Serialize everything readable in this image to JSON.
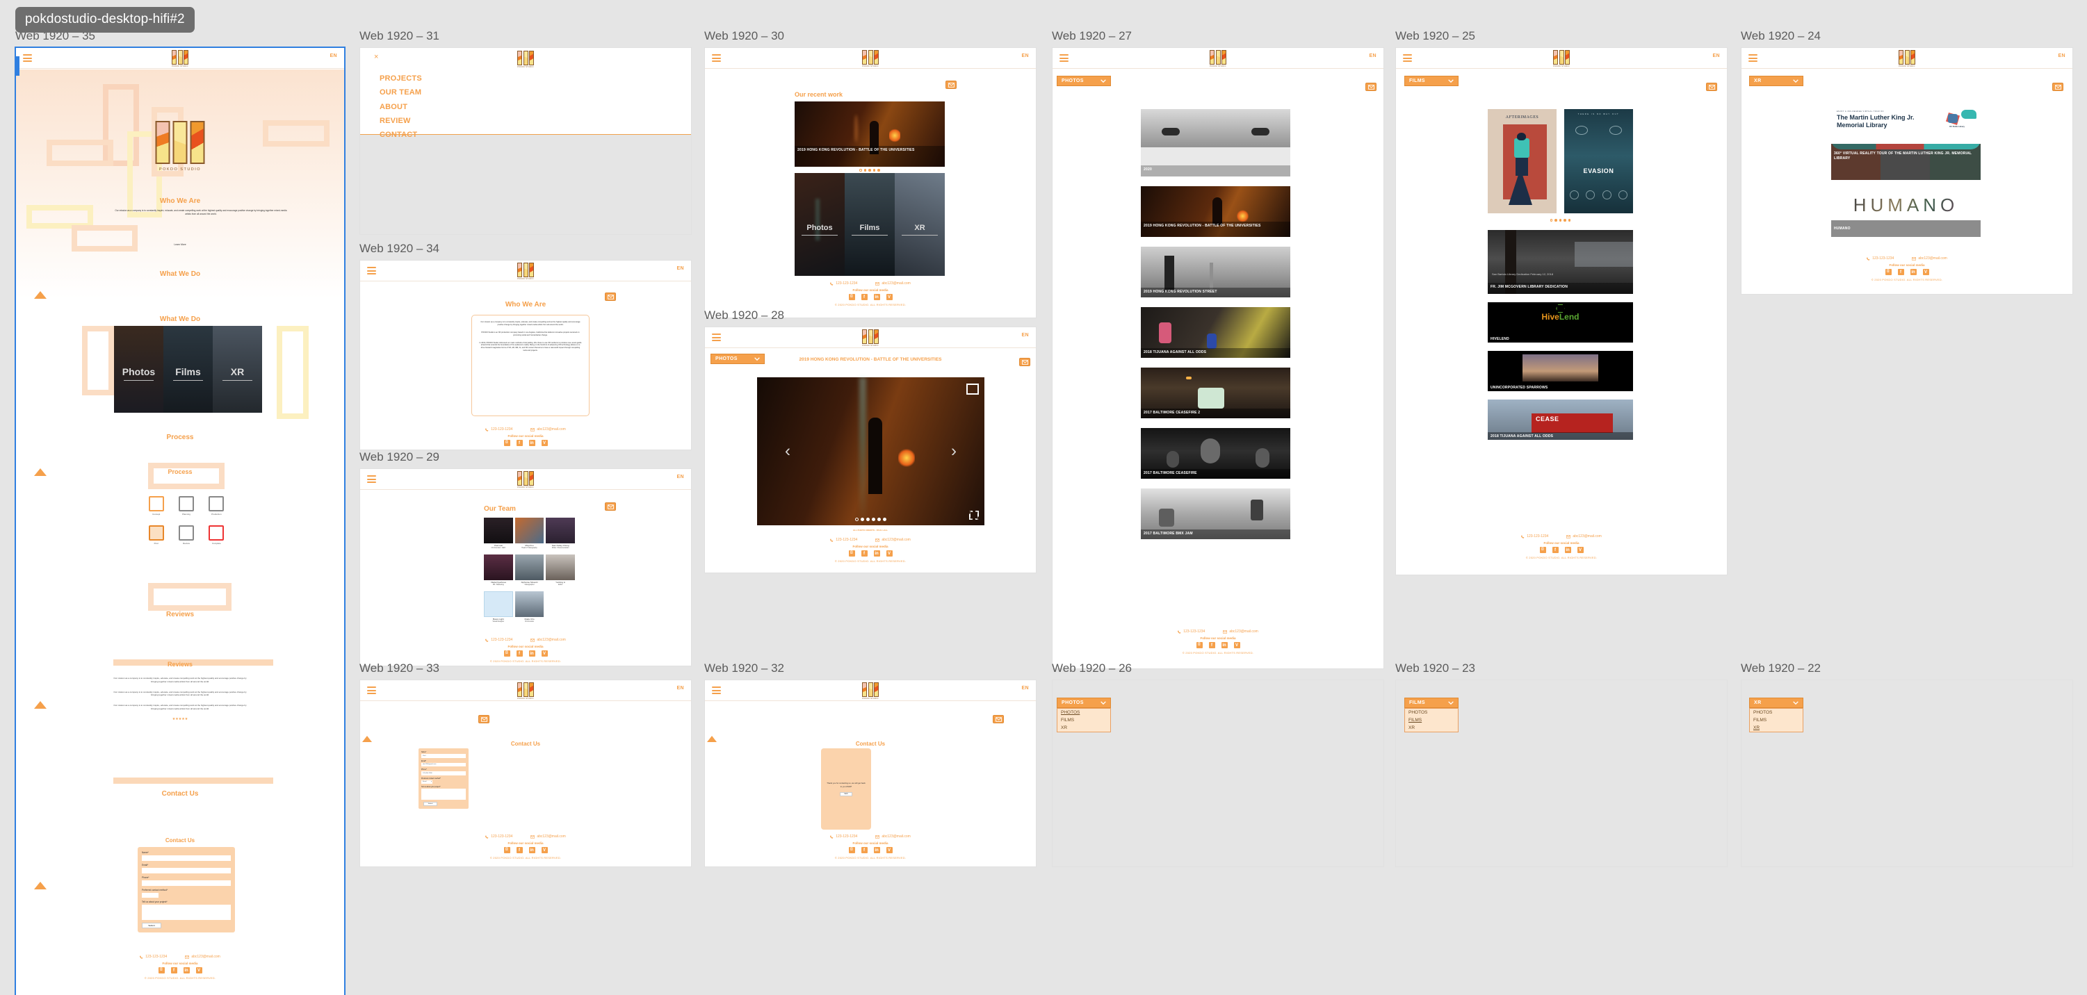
{
  "page": {
    "title": "pokdostudio-desktop-hifi#2"
  },
  "brand": {
    "accent": "#f5a04b",
    "accent_dark": "#e8872a",
    "logo_caption": "POKDO STUDIO",
    "lang": "EN"
  },
  "footer": {
    "phone": "123-123-1234",
    "email": "abc123@mail.com",
    "follow": "Follow our social media",
    "copyright": "© 2020 POKDO STUDIO. ALL RIGHTS RESERVED.",
    "socials": [
      "instagram",
      "facebook",
      "linkedin",
      "vimeo"
    ]
  },
  "frames": [
    {
      "label": "Web 1920 – 35",
      "sections": {
        "who_we_are": "Who We Are",
        "who_we_are_body": "Our mission as a company is to constantly inspire, educate, and create compelling work at the highest quality and encourage positive change by bringing together mixed-media artists from all around the world.",
        "learn_more": "Learn More",
        "what_we_do": "What We Do",
        "what_we_do_2": "What We Do",
        "process": "Process",
        "process_2": "Process",
        "reviews": "Reviews",
        "reviews_2": "Reviews",
        "contact_us": "Contact Us",
        "contact_us_2": "Contact Us"
      },
      "tiles": [
        "Photos",
        "Films",
        "XR"
      ],
      "process_steps": [
        "Concept",
        "Planning",
        "Production",
        "Post",
        "Review",
        "Complete"
      ],
      "review_stars": "★★★★★"
    },
    {
      "label": "Web 1920 – 31",
      "menu": [
        "PROJECTS",
        "OUR TEAM",
        "ABOUT",
        "REVIEW",
        "CONTACT"
      ],
      "close": "×"
    },
    {
      "label": "Web 1920 – 30",
      "heading": "Our recent work",
      "hero_caption": "2019 HONG KONG REVOLUTION - BATTLE OF THE UNIVERSITIES",
      "tiles": [
        "Photos",
        "Films",
        "XR"
      ],
      "dots": 5,
      "active_dot": 1
    },
    {
      "label": "Web 1920 – 27",
      "filter": "PHOTOS",
      "items": [
        "2020",
        "2019 HONG KONG REVOLUTION - BATTLE OF THE UNIVERSITIES",
        "2019 HONG KONG REVOLUTION STREET",
        "2018 TIJUANA AGAINST ALL ODDS",
        "2017 BALTIMORE CEASEFIRE 2",
        "2017 BALTIMORE CEASEFIRE",
        "2017 BALTIMORE BMX JAM"
      ]
    },
    {
      "label": "Web 1920 – 25",
      "filter": "FILMS",
      "posters": [
        "AFTERIMAGES",
        "EVASION"
      ],
      "dots": 5,
      "items": [
        "FR. JIM MCGOVERN LIBRARY DEDICATION",
        "HIVELEND",
        "UNINCORPORATED SPARROWS",
        "2018 TIJUANA AGAINST ALL ODDS"
      ]
    },
    {
      "label": "Web 1920 – 24",
      "filter": "XR",
      "hero_title": "The Martin Luther King Jr. Memorial Library",
      "hero_kicker": "ENJOY A 360-DEGREE VIRTUAL TOUR OF",
      "hero_brand": "DC Public Library",
      "items": [
        "360° VIRTUAL REALITY TOUR OF THE MARTIN LUTHER KING JR. MEMORIAL LIBRARY",
        "HUMANO"
      ],
      "wordmark": "HUMANO"
    },
    {
      "label": "Web 1920 – 34",
      "heading": "Who We Are",
      "paragraphs": [
        "Our mission as a company is to constantly inspire, educate, and create compelling work at the highest quality and encourage positive change by bringing together mixed-media artists from all around the world.",
        "POKDO Studio is an XR production company based in Los Angeles, California that delivers innovative projects centered on promoting social and humanitarian change.",
        "In 2019, POKDO Studio refocused our main methods of storytelling. We chose to use XR mediums to produce new, avant-garde artwork that extends the boundaries of the audience's reality. Being on the forefront of advancing XR technology allows us to drive forward imaginative forms of VR, AR, MR, AI, and XR content that aims to have a real-world impact through compelling tools and projects."
      ]
    },
    {
      "label": "Web 1920 – 29",
      "heading": "Our Team",
      "members": [
        {
          "name": "Paul Lall",
          "role": "CO-Founder / CEO"
        },
        {
          "name": "Minji Kim",
          "role": "Head of Videography"
        },
        {
          "name": "Kian Kelley-Chung",
          "role": "Writer / Documentarian"
        },
        {
          "name": "Vlada Dyacheva",
          "role": "PR / Marketing"
        },
        {
          "name": "Alphonse Silvestri",
          "role": "Videographer"
        },
        {
          "name": "Yunbing Li",
          "role": "Editor"
        },
        {
          "name": "Bosco Light",
          "role": "Visual Designer"
        },
        {
          "name": "Claire Cho",
          "role": "CO-Founder"
        }
      ]
    },
    {
      "label": "Web 1920 – 28",
      "filter": "PHOTOS",
      "title": "2019 HONG KONG REVOLUTION - BATTLE OF THE UNIVERSITIES",
      "credit": "ALL PHOTO CREDITS - PAUL LALL",
      "dots": 6,
      "active_dot": 1,
      "prev": "‹",
      "next": "›"
    },
    {
      "label": "Web 1920 – 33",
      "heading": "Contact Us",
      "fields": [
        {
          "label": "Name*",
          "value": "Paul"
        },
        {
          "label": "Email*",
          "value": "abc123@gmail.com"
        },
        {
          "label": "Phone*",
          "value": "123-456-7890"
        }
      ],
      "select_label": "Preferred contact method*",
      "select_value": "Email",
      "textarea_label": "Tell us about your project*",
      "textarea_value": "",
      "submit": "Submit"
    },
    {
      "label": "Web 1920 – 32",
      "heading": "Contact Us",
      "message": "Thank you for contacting us, we will get back to you ASAP!",
      "back": "back"
    },
    {
      "label": "Web 1920 – 26",
      "filter": "PHOTOS",
      "options": [
        "PHOTOS",
        "FILMS",
        "XR"
      ],
      "active": "PHOTOS"
    },
    {
      "label": "Web 1920 – 23",
      "filter": "FILMS",
      "options": [
        "PHOTOS",
        "FILMS",
        "XR"
      ],
      "active": "FILMS"
    },
    {
      "label": "Web 1920 – 22",
      "filter": "XR",
      "options": [
        "PHOTOS",
        "FILMS",
        "XR"
      ],
      "active": "XR"
    }
  ]
}
